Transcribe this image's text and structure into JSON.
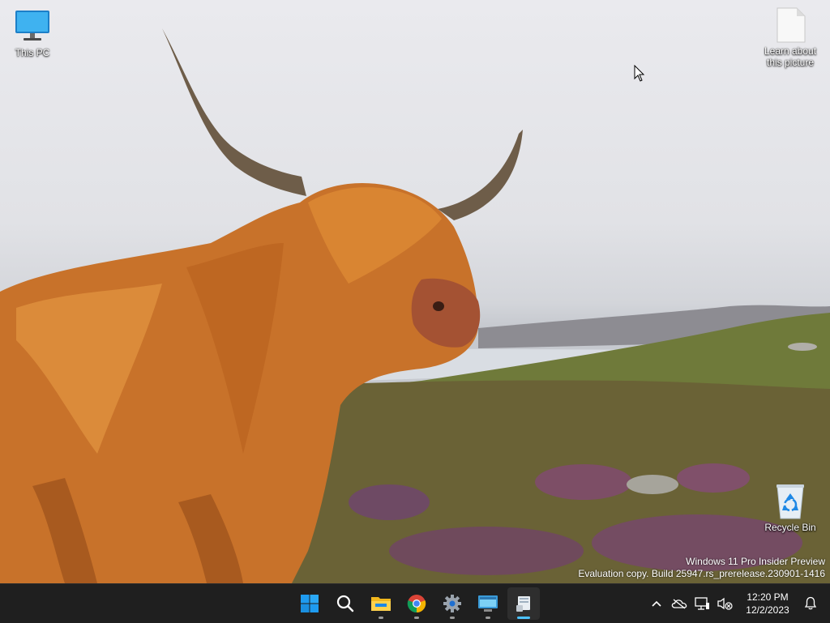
{
  "desktop": {
    "icons": [
      {
        "label": "This PC"
      },
      {
        "label": "Learn about\nthis picture"
      },
      {
        "label": "Recycle Bin"
      }
    ]
  },
  "watermark": {
    "line1": "Windows 11 Pro Insider Preview",
    "line2": "Evaluation copy. Build 25947.rs_prerelease.230901-1416"
  },
  "taskbar": {
    "apps": [
      {
        "name": "Start",
        "icon": "windows-logo-icon"
      },
      {
        "name": "Search",
        "icon": "search-icon"
      },
      {
        "name": "File Explorer",
        "icon": "folder-icon"
      },
      {
        "name": "Google Chrome",
        "icon": "chrome-icon"
      },
      {
        "name": "Settings",
        "icon": "gear-icon"
      },
      {
        "name": "Remote Desktop",
        "icon": "remote-desktop-icon"
      },
      {
        "name": "Active App",
        "icon": "app-icon"
      }
    ],
    "clock": {
      "time": "12:20 PM",
      "date": "12/2/2023"
    }
  },
  "colors": {
    "taskbar_bg": "#1f1f1f",
    "accent": "#4cc2ff",
    "windows_blue": "#1e9bf0"
  }
}
